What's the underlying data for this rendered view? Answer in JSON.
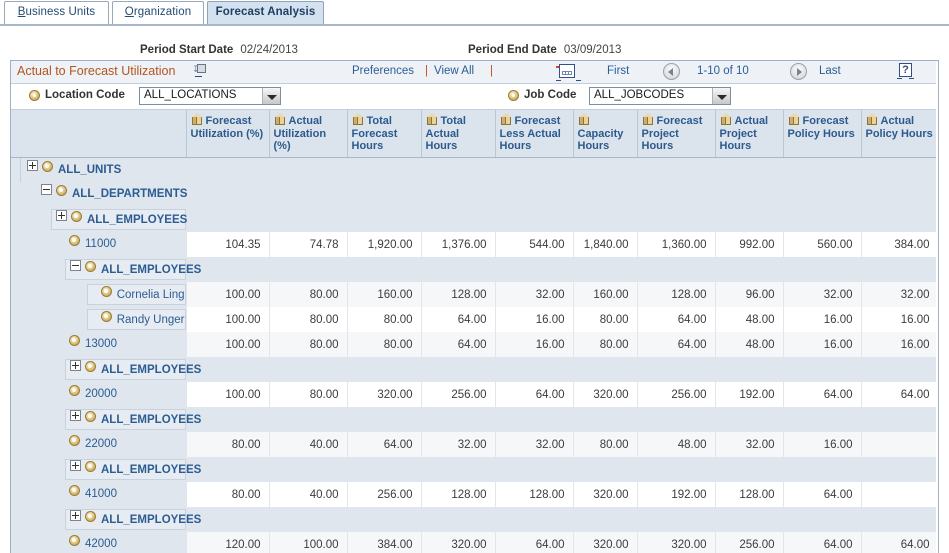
{
  "tabs": [
    {
      "label": "Business Units",
      "accel": "B",
      "active": false
    },
    {
      "label": "Organization",
      "accel": "O",
      "active": false
    },
    {
      "label": "Forecast Analysis",
      "accel": "",
      "active": true
    }
  ],
  "period": {
    "start_label": "Period Start Date",
    "start_value": "02/24/2013",
    "end_label": "Period End Date",
    "end_value": "03/09/2013"
  },
  "grid_header": {
    "title": "Actual to Forecast Utilization",
    "preferences": "Preferences",
    "separator": "|",
    "view_all": "View All",
    "first": "First",
    "count": "1-10 of 10",
    "last": "Last",
    "help": "?"
  },
  "filters": {
    "location_label": "Location Code",
    "location_value": "ALL_LOCATIONS",
    "job_label": "Job Code",
    "job_value": "ALL_JOBCODES"
  },
  "columns": [
    "Forecast Utilization (%)",
    "Actual Utilization (%)",
    "Total Forecast Hours",
    "Total Actual Hours",
    "Forecast Less Actual Hours",
    "Capacity Hours",
    "Forecast Project Hours",
    "Actual Project Hours",
    "Forecast Policy Hours",
    "Actual Policy Hours"
  ],
  "rows": [
    {
      "label": "ALL_UNITS",
      "indent": 0,
      "expander": "plus",
      "boxed": false,
      "bold": true,
      "shade": "node",
      "values": []
    },
    {
      "label": "ALL_DEPARTMENTS",
      "indent": 1,
      "expander": "minus",
      "boxed": false,
      "bold": true,
      "shade": "node",
      "values": []
    },
    {
      "label": "ALL_EMPLOYEES",
      "indent": 2,
      "expander": "plus",
      "boxed": true,
      "bold": true,
      "shade": "node",
      "values": []
    },
    {
      "label": "11000",
      "indent": 3,
      "expander": "none",
      "boxed": false,
      "bold": false,
      "shade": "white",
      "values": [
        "104.35",
        "74.78",
        "1,920.00",
        "1,376.00",
        "544.00",
        "1,840.00",
        "1,360.00",
        "992.00",
        "560.00",
        "384.00"
      ]
    },
    {
      "label": "ALL_EMPLOYEES",
      "indent": 3,
      "expander": "minus",
      "boxed": true,
      "bold": true,
      "shade": "node",
      "values": []
    },
    {
      "label": "Cornelia Ling",
      "indent": 4,
      "expander": "none",
      "boxed": true,
      "bold": false,
      "shade": "alt",
      "values": [
        "100.00",
        "80.00",
        "160.00",
        "128.00",
        "32.00",
        "160.00",
        "128.00",
        "96.00",
        "32.00",
        "32.00"
      ]
    },
    {
      "label": "Randy Unger",
      "indent": 4,
      "expander": "none",
      "boxed": true,
      "bold": false,
      "shade": "white",
      "values": [
        "100.00",
        "80.00",
        "80.00",
        "64.00",
        "16.00",
        "80.00",
        "64.00",
        "48.00",
        "16.00",
        "16.00"
      ]
    },
    {
      "label": "13000",
      "indent": 3,
      "expander": "none",
      "boxed": false,
      "bold": false,
      "shade": "alt",
      "values": [
        "100.00",
        "80.00",
        "80.00",
        "64.00",
        "16.00",
        "80.00",
        "64.00",
        "48.00",
        "16.00",
        "16.00"
      ]
    },
    {
      "label": "ALL_EMPLOYEES",
      "indent": 3,
      "expander": "plus",
      "boxed": true,
      "bold": true,
      "shade": "node",
      "values": []
    },
    {
      "label": "20000",
      "indent": 3,
      "expander": "none",
      "boxed": false,
      "bold": false,
      "shade": "white",
      "values": [
        "100.00",
        "80.00",
        "320.00",
        "256.00",
        "64.00",
        "320.00",
        "256.00",
        "192.00",
        "64.00",
        "64.00"
      ]
    },
    {
      "label": "ALL_EMPLOYEES",
      "indent": 3,
      "expander": "plus",
      "boxed": true,
      "bold": true,
      "shade": "node",
      "values": []
    },
    {
      "label": "22000",
      "indent": 3,
      "expander": "none",
      "boxed": false,
      "bold": false,
      "shade": "alt",
      "values": [
        "80.00",
        "40.00",
        "64.00",
        "32.00",
        "32.00",
        "80.00",
        "48.00",
        "32.00",
        "16.00",
        ""
      ]
    },
    {
      "label": "ALL_EMPLOYEES",
      "indent": 3,
      "expander": "plus",
      "boxed": true,
      "bold": true,
      "shade": "node",
      "values": []
    },
    {
      "label": "41000",
      "indent": 3,
      "expander": "none",
      "boxed": false,
      "bold": false,
      "shade": "white",
      "values": [
        "80.00",
        "40.00",
        "256.00",
        "128.00",
        "128.00",
        "320.00",
        "192.00",
        "128.00",
        "64.00",
        ""
      ]
    },
    {
      "label": "ALL_EMPLOYEES",
      "indent": 3,
      "expander": "plus",
      "boxed": true,
      "bold": true,
      "shade": "node",
      "values": []
    },
    {
      "label": "42000",
      "indent": 3,
      "expander": "none",
      "boxed": false,
      "bold": false,
      "shade": "alt",
      "values": [
        "120.00",
        "100.00",
        "384.00",
        "320.00",
        "64.00",
        "320.00",
        "320.00",
        "256.00",
        "64.00",
        "64.00"
      ]
    }
  ]
}
